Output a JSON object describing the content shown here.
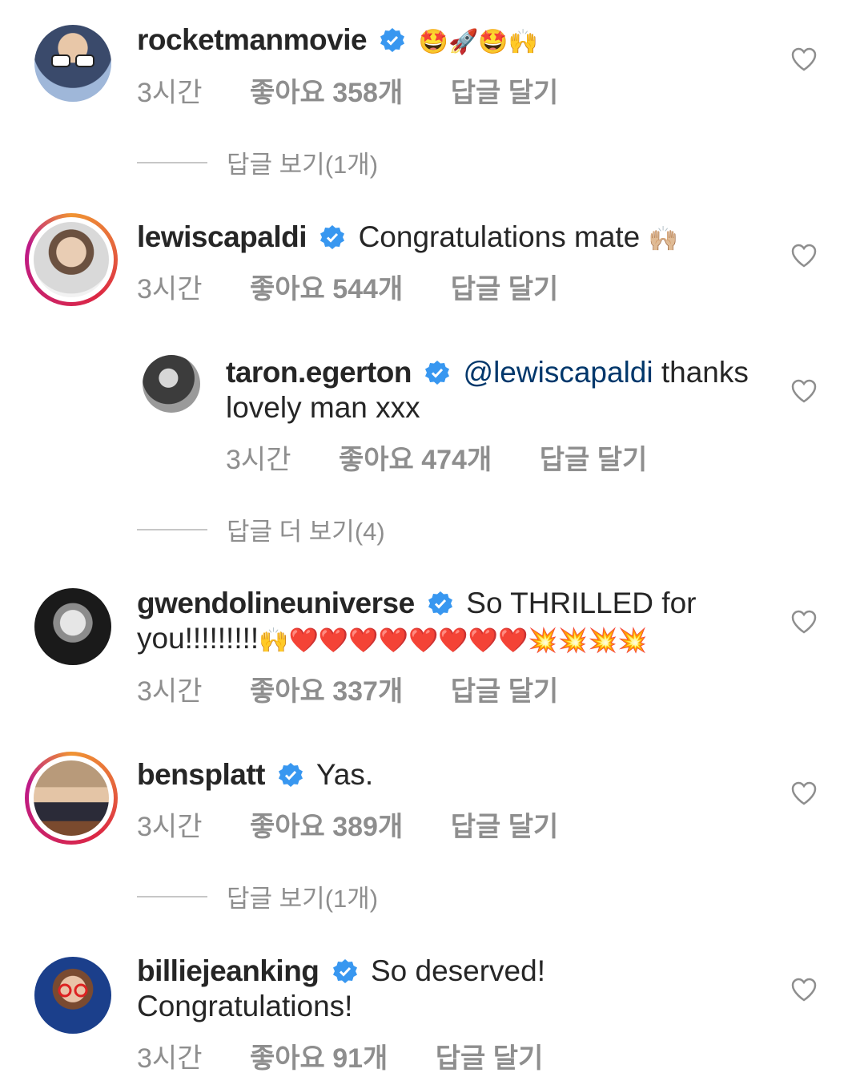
{
  "colors": {
    "verified": "#3897f0",
    "meta": "#8e8e8e",
    "mention": "#00376b"
  },
  "comments": [
    {
      "username": "rocketmanmovie",
      "text": "",
      "emoji": "🤩🚀🤩🙌",
      "time": "3시간",
      "likes": "좋아요 358개",
      "reply": "답글 달기",
      "view_replies": "답글 보기(1개)"
    },
    {
      "username": "lewiscapaldi",
      "text": "Congratulations mate",
      "emoji": "🙌🏼",
      "time": "3시간",
      "likes": "좋아요 544개",
      "reply": "답글 달기",
      "view_replies": ""
    },
    {
      "username": "taron.egerton",
      "mention": "@lewiscapaldi",
      "text": " thanks lovely man xxx",
      "emoji": "",
      "time": "3시간",
      "likes": "좋아요 474개",
      "reply": "답글 달기",
      "view_replies": "답글 더 보기(4)"
    },
    {
      "username": "gwendolineuniverse",
      "text": "So THRILLED for you!!!!!!!!!",
      "emoji": "🙌❤️❤️❤️❤️❤️❤️❤️❤️💥💥💥💥",
      "time": "3시간",
      "likes": "좋아요 337개",
      "reply": "답글 달기",
      "view_replies": ""
    },
    {
      "username": "bensplatt",
      "text": "Yas.",
      "emoji": "",
      "time": "3시간",
      "likes": "좋아요 389개",
      "reply": "답글 달기",
      "view_replies": "답글 보기(1개)"
    },
    {
      "username": "billiejeanking",
      "text": "So deserved! Congratulations!",
      "emoji": "",
      "time": "3시간",
      "likes": "좋아요 91개",
      "reply": "답글 달기",
      "view_replies": ""
    }
  ]
}
